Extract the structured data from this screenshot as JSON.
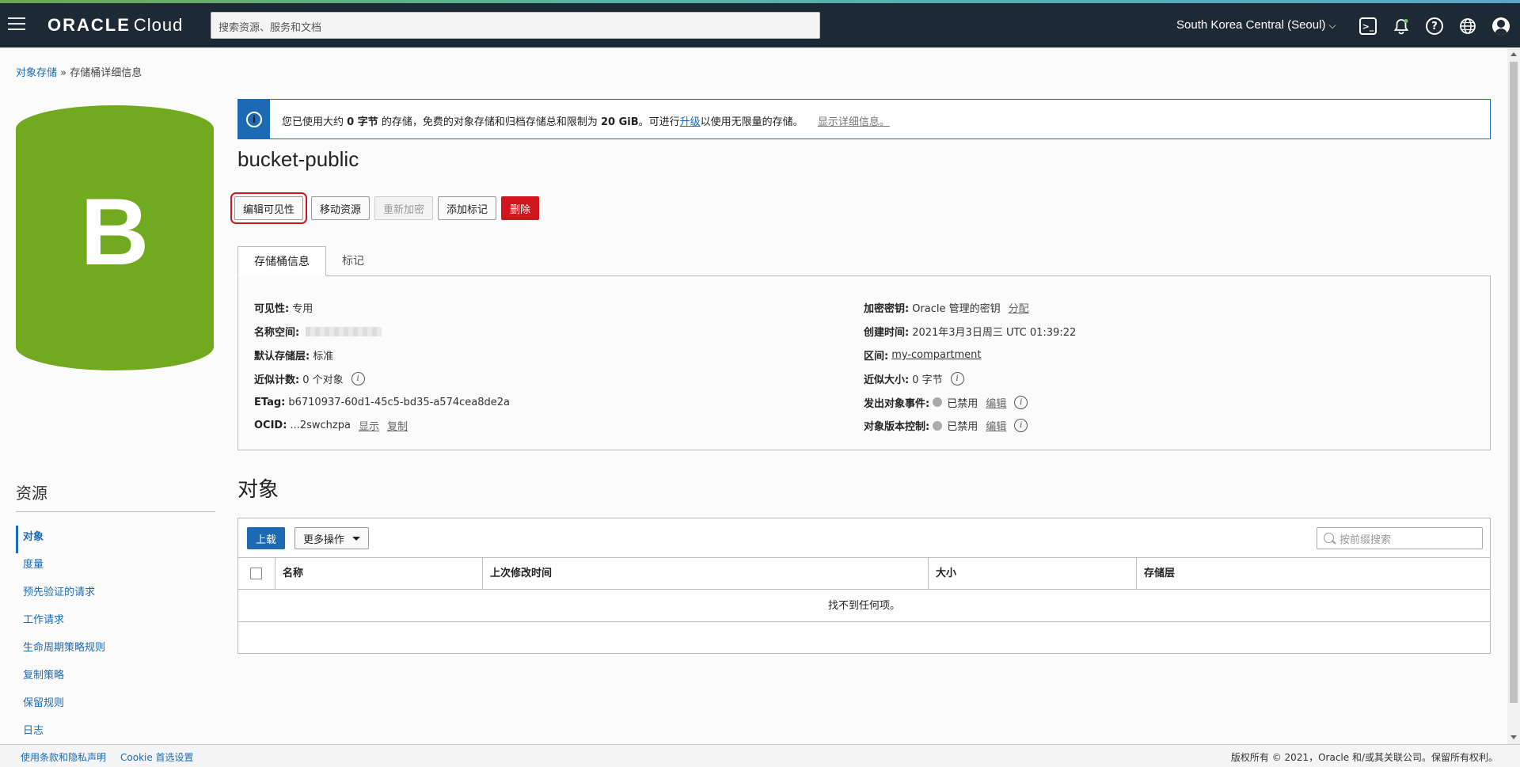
{
  "colors": {
    "nav_bg": "#1d2a35",
    "accent": "#1b6ab3",
    "danger": "#d0161c",
    "bucket": "#72aa1f"
  },
  "topbar": {
    "logo_main": "ORACLE",
    "logo_sub": "Cloud",
    "search_placeholder": "搜索资源、服务和文档",
    "region": "South Korea Central (Seoul)",
    "icons": [
      "cloud-shell-icon",
      "notification-bell-icon",
      "help-icon",
      "language-globe-icon",
      "user-profile-icon"
    ]
  },
  "breadcrumb": {
    "root": "对象存储",
    "sep": "»",
    "current": "存储桶详细信息"
  },
  "bucket_avatar_letter": "B",
  "banner": {
    "t1": "您已使用大约 ",
    "t2": "0 字节",
    "t3": " 的存储，免费的对象存储和归档存储总和限制为 ",
    "t4": "20 GiB",
    "t5": "。可进行",
    "upgrade": "升级",
    "t6": "以使用无限量的存储。",
    "details": "显示详细信息。"
  },
  "title": "bucket-public",
  "buttons": {
    "edit_visibility": "编辑可见性",
    "move": "移动资源",
    "reencrypt": "重新加密",
    "add_tags": "添加标记",
    "delete": "删除"
  },
  "tabs": {
    "info": "存储桶信息",
    "tags": "标记"
  },
  "info": {
    "visibility_label": "可见性:",
    "visibility": "专用",
    "namespace_label": "名称空间:",
    "tier_label": "默认存储层:",
    "tier": "标准",
    "count_label": "近似计数:",
    "count": "0 个对象",
    "etag_label": "ETag:",
    "etag": "b6710937-60d1-45c5-bd35-a574cea8de2a",
    "ocid_label": "OCID:",
    "ocid": "...2swchzpa",
    "show": "显示",
    "copy": "复制",
    "key_label": "加密密钥:",
    "key": "Oracle 管理的密钥",
    "assign": "分配",
    "created_label": "创建时间:",
    "created": "2021年3月3日周三 UTC 01:39:22",
    "compartment_label": "区间:",
    "compartment": "my-compartment",
    "size_label": "近似大小:",
    "size": "0 字节",
    "events_label": "发出对象事件:",
    "events": "已禁用",
    "edit": "编辑",
    "versioning_label": "对象版本控制:",
    "versioning": "已禁用"
  },
  "resources": {
    "title": "资源",
    "items": [
      "对象",
      "度量",
      "预先验证的请求",
      "工作请求",
      "生命周期策略规则",
      "复制策略",
      "保留规则",
      "日志"
    ]
  },
  "objects": {
    "title": "对象",
    "upload": "上载",
    "more": "更多操作",
    "search_placeholder": "按前缀搜索",
    "columns": [
      "名称",
      "上次修改时间",
      "大小",
      "存储层"
    ],
    "empty": "找不到任何项。"
  },
  "footer": {
    "terms": "使用条款和隐私声明",
    "cookie": "Cookie 首选设置",
    "copyright": "版权所有 © 2021，Oracle 和/或其关联公司。保留所有权利。"
  }
}
